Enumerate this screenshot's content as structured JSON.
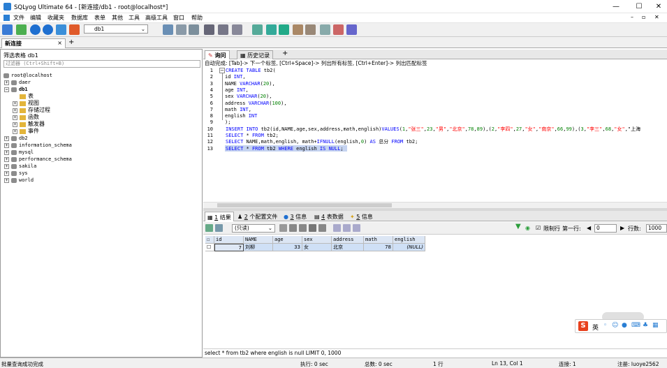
{
  "window": {
    "title": "SQLyog Ultimate 64 - [新连接/db1 - root@localhost*]",
    "min": "—",
    "max": "☐",
    "close": "✕"
  },
  "menu": [
    "文件",
    "编辑",
    "收藏夹",
    "数据库",
    "表单",
    "其他",
    "工具",
    "高级工具",
    "窗口",
    "帮助"
  ],
  "toolbar": {
    "db_select": "db1"
  },
  "connection_tab": {
    "label": "新连接",
    "close": "×",
    "add": "+"
  },
  "left": {
    "filter_label": "筛选表格 db1",
    "filter_placeholder": "过滤器 (Ctrl+Shift+B)",
    "tree": {
      "root": "root@localhost",
      "dbs": [
        "daer",
        "db1",
        "db2",
        "information_schema",
        "mysql",
        "performance_schema",
        "sakila",
        "sys",
        "world"
      ],
      "db1_children": [
        "表",
        "视图",
        "存储过程",
        "函数",
        "触发器",
        "事件"
      ]
    }
  },
  "editor": {
    "tabs": [
      "询问",
      "历史记录"
    ],
    "add": "+",
    "hint": "自动完成: [Tab]-> 下一个标签, [Ctrl+Space]-> 列出所有标签, [Ctrl+Enter]-> 列出匹配标签",
    "lines": [
      "CREATE TABLE tb2(",
      "id INT,",
      "NAME VARCHAR(20),",
      "age INT,",
      "sex VARCHAR(20),",
      "address VARCHAR(100),",
      "math INT,",
      "english INT",
      ");",
      "INSERT INTO tb2(id,NAME,age,sex,address,math,english)VALUES(1,\"张三\",23,\"男\",\"北京\",78,89),(2,\"李四\",27,\"女\",\"南京\",66,99),(3,\"李三\",68,\"女\",\"上海",
      "SELECT * FROM tb2;",
      "SELECT NAME,math,english, math+IFNULL(english,0) AS 总分 FROM tb2;",
      "SELECT * FROM tb2 WHERE english IS NULL;"
    ]
  },
  "results": {
    "tabs": [
      {
        "num": "1",
        "label": "结果"
      },
      {
        "num": "2",
        "label": "个配置文件"
      },
      {
        "num": "3",
        "label": "信息"
      },
      {
        "num": "4",
        "label": "表数据"
      },
      {
        "num": "5",
        "label": "信息"
      }
    ],
    "readonly": "(只读)",
    "limit_rows": "限制行",
    "first_row": "第一行:",
    "first_row_value": "0",
    "rows_label": "行数:",
    "rows_value": "1000",
    "columns": [
      "id",
      "NAME",
      "age",
      "sex",
      "address",
      "math",
      "english"
    ],
    "rows": [
      [
        "7",
        "刘柳",
        "33",
        "女",
        "北京",
        "78",
        "(NULL)"
      ]
    ],
    "sql": "select * from tb2 where english is null LIMIT 0, 1000"
  },
  "status": {
    "left": "批量查询成功完成",
    "exec": "执行: 0 sec",
    "total": "总数: 0 sec",
    "rows": "1 行",
    "pos": "Ln 13, Col 1",
    "conn": "连接: 1",
    "reg": "注册: luoye2562"
  },
  "ime": {
    "logo": "S",
    "lang": "英"
  },
  "colors": {
    "keyword": "#0000ff",
    "string": "#ff0000",
    "number": "#008000"
  }
}
